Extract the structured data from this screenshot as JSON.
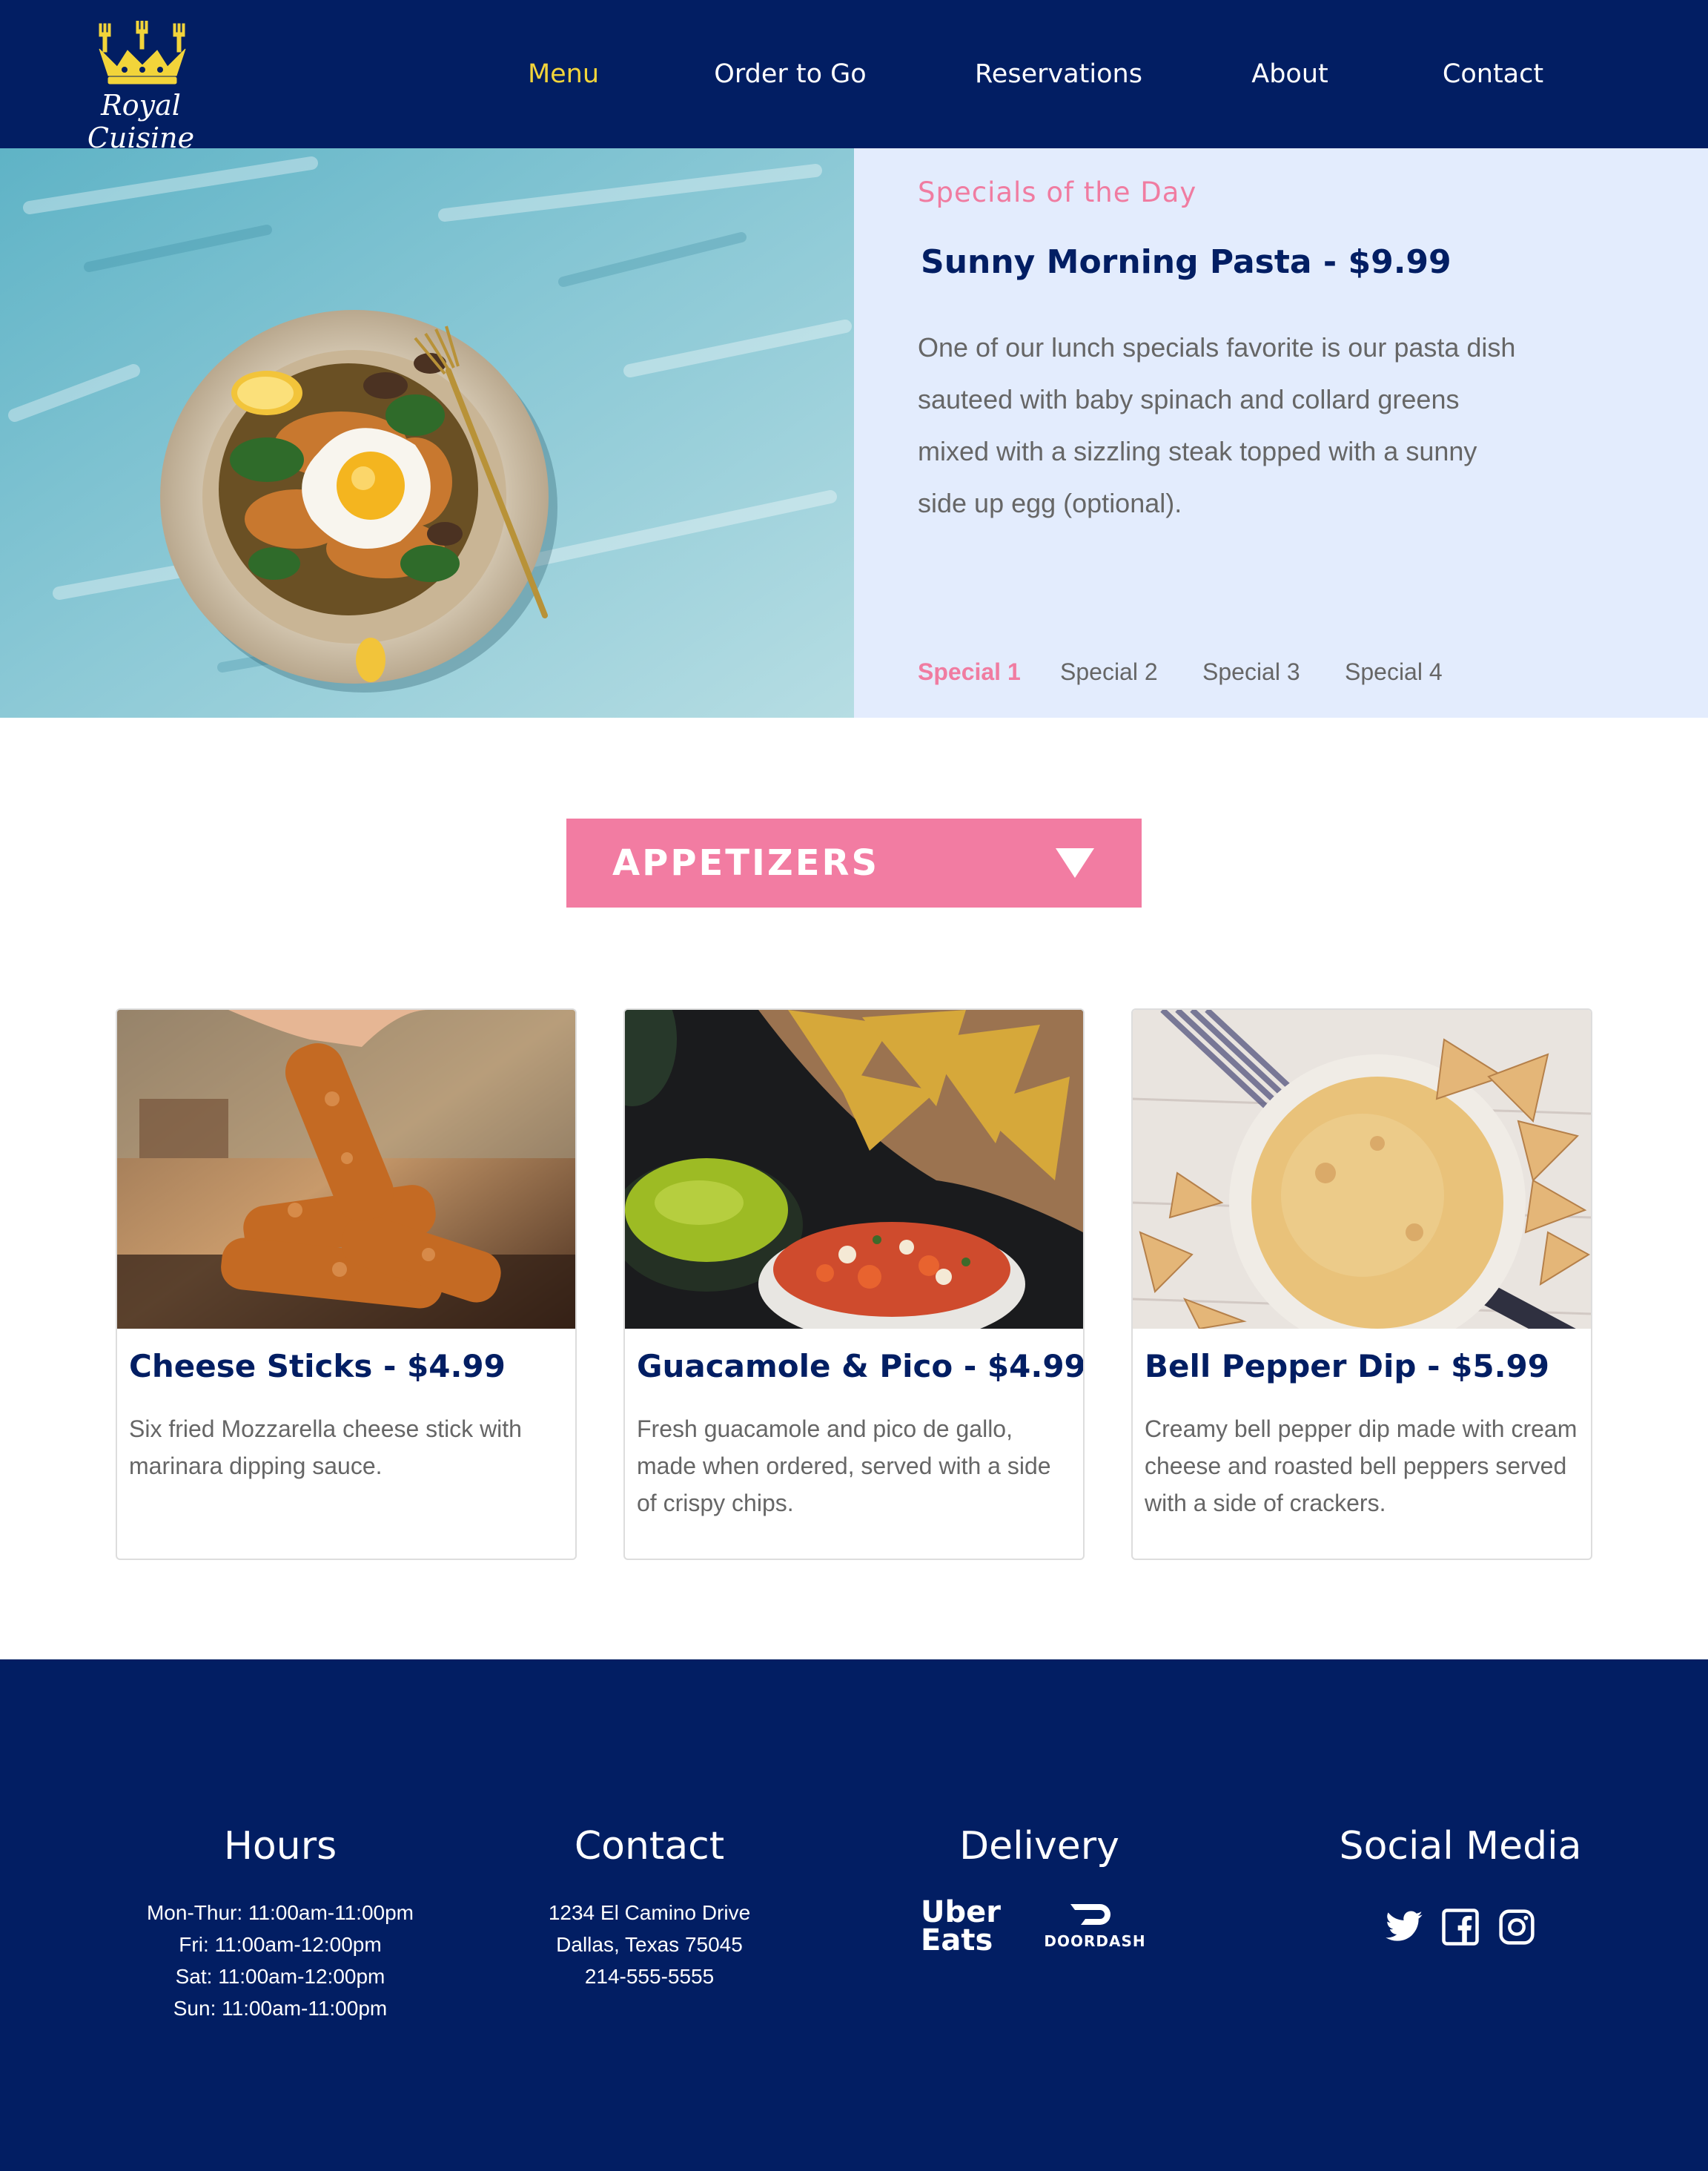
{
  "brand": {
    "name": "Royal Cuisine"
  },
  "colors": {
    "navy": "#021e63",
    "pink": "#f27ca2",
    "gold": "#f2d43a",
    "panel": "#e3ecfd"
  },
  "nav": [
    {
      "label": "Menu",
      "active": true
    },
    {
      "label": "Order to Go"
    },
    {
      "label": "Reservations"
    },
    {
      "label": "About"
    },
    {
      "label": "Contact"
    }
  ],
  "specials": {
    "heading": "Specials of the Day",
    "title": "Sunny Morning Pasta - $9.99",
    "description": "One of our lunch specials favorite is our pasta dish sauteed with baby spinach and collard greens mixed with a sizzling steak topped with a sunny side up egg (optional).",
    "tabs": [
      "Special 1",
      "Special 2",
      "Special 3",
      "Special 4"
    ],
    "active_tab": "Special 1"
  },
  "category": {
    "label": "APPETIZERS",
    "icon": "triangle-down-icon"
  },
  "items": [
    {
      "title": "Cheese Sticks - $4.99",
      "description": "Six fried Mozzarella cheese stick with marinara dipping sauce."
    },
    {
      "title": "Guacamole & Pico - $4.99",
      "description": "Fresh guacamole and pico de gallo, made when ordered, served with a side of crispy chips."
    },
    {
      "title": "Bell Pepper Dip - $5.99",
      "description": "Creamy bell pepper dip made with cream cheese and roasted bell peppers served with a side of crackers."
    }
  ],
  "footer": {
    "hours": {
      "heading": "Hours",
      "lines": [
        "Mon-Thur: 11:00am-11:00pm",
        "Fri: 11:00am-12:00pm",
        "Sat: 11:00am-12:00pm",
        "Sun: 11:00am-11:00pm"
      ]
    },
    "contact": {
      "heading": "Contact",
      "lines": [
        "1234 El Camino Drive",
        "Dallas, Texas 75045",
        "214-555-5555"
      ]
    },
    "delivery": {
      "heading": "Delivery",
      "ubereats": [
        "Uber",
        "Eats"
      ],
      "doordash": "DOORDASH"
    },
    "social": {
      "heading": "Social Media",
      "icons": [
        "twitter-icon",
        "facebook-icon",
        "instagram-icon"
      ]
    }
  }
}
